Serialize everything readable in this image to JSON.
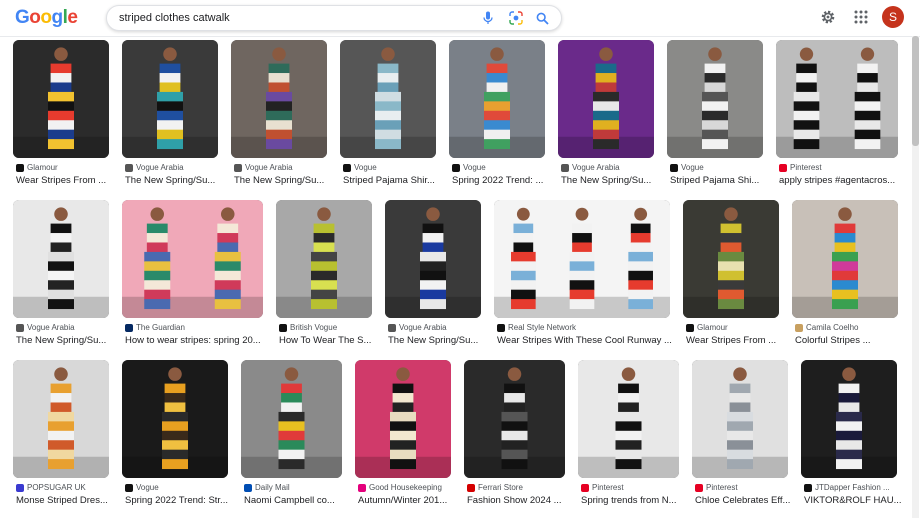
{
  "header": {
    "logo": "Google",
    "search_value": "striped clothes catwalk",
    "icons": {
      "mic": "mic-icon",
      "lens": "camera-lens-icon",
      "search": "search-icon",
      "settings": "gear-icon",
      "apps": "apps-grid-icon"
    },
    "avatar_letter": "S",
    "colors": {
      "blue": "#4285f4",
      "red": "#ea4335",
      "yellow": "#fbbc05",
      "green": "#34a853",
      "avatar": "#c5331c"
    }
  },
  "results": [
    {
      "source": "Glamour",
      "title": "Wear Stripes From ...",
      "fav_color": "#111111",
      "bg": "#2b2b2b",
      "stripes": [
        "#e63b2e",
        "#f2f2f2",
        "#1b3c8c",
        "#f2c230",
        "#111111"
      ]
    },
    {
      "source": "Vogue Arabia",
      "title": "The New Spring/Su...",
      "fav_color": "#555555",
      "bg": "#3a3a3a",
      "stripes": [
        "#1f4fa0",
        "#f2f2f2",
        "#e0c020",
        "#2fa0a8",
        "#111111"
      ]
    },
    {
      "source": "Vogue Arabia",
      "title": "The New Spring/Su...",
      "fav_color": "#555555",
      "bg": "#6f6660",
      "stripes": [
        "#2e6b5a",
        "#e8e0d0",
        "#c05030",
        "#6a4aa0",
        "#222222"
      ]
    },
    {
      "source": "Vogue",
      "title": "Striped Pajama Shir...",
      "fav_color": "#111111",
      "bg": "#565656",
      "stripes": [
        "#8ab8c8",
        "#e8eef0",
        "#6aa0b8",
        "#d0dde2"
      ]
    },
    {
      "source": "Vogue",
      "title": "Spring 2022 Trend: ...",
      "fav_color": "#111111",
      "bg": "#7a8088",
      "stripes": [
        "#e04a3a",
        "#3a8ad0",
        "#f0f0f0",
        "#40a060",
        "#e8a030"
      ]
    },
    {
      "source": "Vogue Arabia",
      "title": "The New Spring/Su...",
      "fav_color": "#555555",
      "bg": "#6a2a8a",
      "stripes": [
        "#1a6a8a",
        "#e0b020",
        "#c03a3a",
        "#2a2a2a",
        "#e8e8e8"
      ]
    },
    {
      "source": "Vogue",
      "title": "Striped Pajama Shi...",
      "fav_color": "#111111",
      "bg": "#8a8a88",
      "stripes": [
        "#f2f2f2",
        "#2a2a2a",
        "#d8d8d8",
        "#555555"
      ]
    },
    {
      "source": "Pinterest",
      "title": "apply stripes #agentacros...",
      "fav_color": "#e60023",
      "bg": "#bdbdbd",
      "stripes": [
        "#111111",
        "#f2f2f2",
        "#111111",
        "#e8e8e8"
      ]
    },
    {
      "source": "Vogue Arabia",
      "title": "The New Spring/Su...",
      "fav_color": "#555555",
      "bg": "#e8e8e8",
      "stripes": [
        "#111111",
        "#f4f4f4",
        "#222222",
        "#e0e0e0"
      ]
    },
    {
      "source": "The Guardian",
      "title": "How to wear stripes: spring 20...",
      "fav_color": "#052962",
      "bg": "#f0a8b8",
      "stripes": [
        "#2a8a6a",
        "#f4e8d8",
        "#d03a5a",
        "#4a6ab0",
        "#e8c040"
      ]
    },
    {
      "source": "British Vogue",
      "title": "How To Wear The S...",
      "fav_color": "#111111",
      "bg": "#a8a8a8",
      "stripes": [
        "#b8c030",
        "#2a2a2a",
        "#d8e050",
        "#444444"
      ]
    },
    {
      "source": "Vogue Arabia",
      "title": "The New Spring/Su...",
      "fav_color": "#555555",
      "bg": "#3a3a3a",
      "stripes": [
        "#111111",
        "#f2f2f2",
        "#1a3aa0",
        "#e8e8e8",
        "#222222"
      ]
    },
    {
      "source": "Real Style Network",
      "title": "Wear Stripes With These Cool Runway ...",
      "fav_color": "#111111",
      "bg": "#f4f4f4",
      "stripes": [
        "#7ab0d8",
        "#f2f2f2",
        "#111111",
        "#e63b2e",
        "#f2f2f2"
      ]
    },
    {
      "source": "Glamour",
      "title": "Wear Stripes From ...",
      "fav_color": "#111111",
      "bg": "#3a3a34",
      "stripes": [
        "#d0c030",
        "#3a3a3a",
        "#e05a30",
        "#6a8a40",
        "#e8e0b0"
      ]
    },
    {
      "source": "Camila Coelho",
      "title": "Colorful Stripes ...",
      "fav_color": "#c8a060",
      "bg": "#c8c0b8",
      "stripes": [
        "#e03a3a",
        "#2a8ad0",
        "#e8c020",
        "#3aa050",
        "#d03a9a"
      ]
    },
    {
      "source": "POPSUGAR UK",
      "title": "Monse Striped Dres...",
      "fav_color": "#3a3ad0",
      "bg": "#d8d8d8",
      "stripes": [
        "#e8a030",
        "#f2f2f2",
        "#d05a2a",
        "#f0d8a0"
      ]
    },
    {
      "source": "Vogue",
      "title": "Spring 2022 Trend: Str...",
      "fav_color": "#111111",
      "bg": "#1a1a1a",
      "stripes": [
        "#e8a020",
        "#3a2a1a",
        "#f0c040",
        "#2a2a2a"
      ]
    },
    {
      "source": "Daily Mail",
      "title": "Naomi Campbell co...",
      "fav_color": "#004db3",
      "bg": "#8a8a8a",
      "stripes": [
        "#e03a3a",
        "#2a8a5a",
        "#f2f2f2",
        "#2a2a2a",
        "#e8c020"
      ]
    },
    {
      "source": "Good Housekeeping",
      "title": "Autumn/Winter 201...",
      "fav_color": "#e4007c",
      "bg": "#d03a6a",
      "stripes": [
        "#111111",
        "#f2e8d0",
        "#222222",
        "#e8dcc0"
      ]
    },
    {
      "source": "Ferrari Store",
      "title": "Fashion Show 2024 ...",
      "fav_color": "#d40000",
      "bg": "#2a2a2a",
      "stripes": [
        "#111111",
        "#e8e8e8",
        "#222222",
        "#555555"
      ]
    },
    {
      "source": "Pinterest",
      "title": "Spring trends from N...",
      "fav_color": "#e60023",
      "bg": "#e8e8e8",
      "stripes": [
        "#111111",
        "#f2f2f2",
        "#222222",
        "#e8e8e8"
      ]
    },
    {
      "source": "Pinterest",
      "title": "Chloe Celebrates Eff...",
      "fav_color": "#e60023",
      "bg": "#e0e0e0",
      "stripes": [
        "#a0a8b0",
        "#e8e8e8",
        "#8a9098",
        "#d8dce0"
      ]
    },
    {
      "source": "JTDapper Fashion ...",
      "title": "VIKTOR&ROLF HAU...",
      "fav_color": "#111111",
      "bg": "#1e1e1e",
      "stripes": [
        "#f2f2f2",
        "#1a1a3a",
        "#e8e8e8",
        "#2a2a4a"
      ]
    }
  ]
}
